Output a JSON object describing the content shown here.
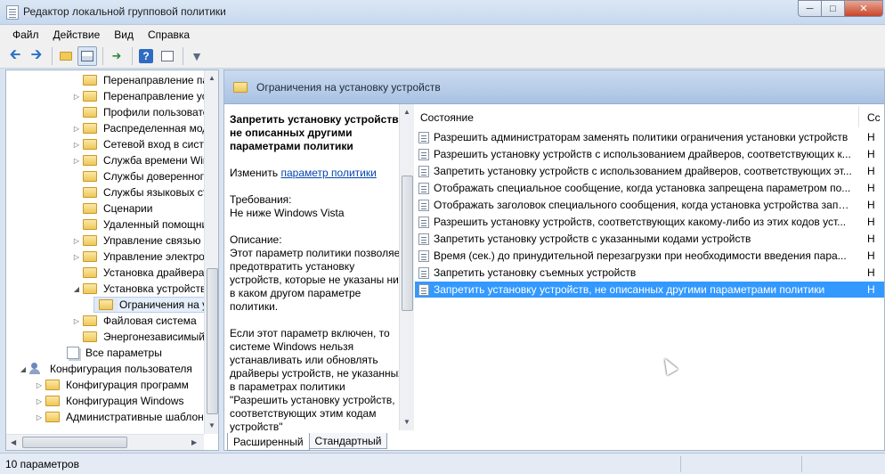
{
  "window": {
    "title": "Редактор локальной групповой политики"
  },
  "menu": [
    "Файл",
    "Действие",
    "Вид",
    "Справка"
  ],
  "tree": {
    "items": [
      {
        "label": "Перенаправление пап",
        "expandable": false
      },
      {
        "label": "Перенаправление устр",
        "expandable": true
      },
      {
        "label": "Профили пользовател",
        "expandable": false
      },
      {
        "label": "Распределенная моде",
        "expandable": true
      },
      {
        "label": "Сетевой вход в систем",
        "expandable": true
      },
      {
        "label": "Служба времени Wind",
        "expandable": true
      },
      {
        "label": "Службы доверенного",
        "expandable": false
      },
      {
        "label": "Службы языковых ста",
        "expandable": false
      },
      {
        "label": "Сценарии",
        "expandable": false
      },
      {
        "label": "Удаленный помощник",
        "expandable": false
      },
      {
        "label": "Управление связью че",
        "expandable": true
      },
      {
        "label": "Управление электропи",
        "expandable": true
      },
      {
        "label": "Установка драйвера",
        "expandable": false
      },
      {
        "label": "Установка устройства",
        "expandable": "open"
      },
      {
        "label": "Ограничения на ус",
        "expandable": false,
        "selected": true
      },
      {
        "label": "Файловая система",
        "expandable": true
      },
      {
        "label": "Энергонезависимый к",
        "expandable": false
      },
      {
        "label": "Все параметры",
        "expandable": false,
        "icon": "pages-icon"
      },
      {
        "label": "Конфигурация пользователя",
        "expandable": "open",
        "icon": "users-icon"
      },
      {
        "label": "Конфигурация программ",
        "expandable": true
      },
      {
        "label": "Конфигурация Windows",
        "expandable": true
      },
      {
        "label": "Административные шаблоны",
        "expandable": true
      }
    ]
  },
  "header": {
    "title": "Ограничения на установку устройств"
  },
  "description": {
    "title": "Запретить установку устройств, не описанных другими параметрами политики",
    "edit_prefix": "Изменить",
    "edit_link": "параметр политики",
    "req_label": "Требования:",
    "req_value": "Не ниже Windows Vista",
    "desc_label": "Описание:",
    "desc_body": "Этот параметр политики позволяет предотвратить установку устройств, которые не указаны ни в каком другом параметре политики.",
    "desc_more": "Если этот параметр включен, то системе Windows нельзя устанавливать или обновлять драйверы устройств, не указанных в параметрах политики \"Разрешить установку устройств, соответствующих этим кодам устройств\""
  },
  "list": {
    "col_state": "Состояние",
    "col_state2": "Сс",
    "rows": [
      {
        "name": "Разрешить администраторам заменять политики ограничения установки устройств",
        "state": "Н"
      },
      {
        "name": "Разрешить установку устройств с использованием драйверов, соответствующих к...",
        "state": "Н"
      },
      {
        "name": "Запретить установку устройств с использованием драйверов, соответствующих эт...",
        "state": "Н"
      },
      {
        "name": "Отображать специальное сообщение, когда установка запрещена параметром по...",
        "state": "Н"
      },
      {
        "name": "Отображать заголовок специального сообщения, когда установка устройства запр...",
        "state": "Н"
      },
      {
        "name": "Разрешить установку устройств, соответствующих какому-либо из этих кодов уст...",
        "state": "Н"
      },
      {
        "name": "Запретить установку устройств с указанными кодами устройств",
        "state": "Н"
      },
      {
        "name": "Время (сек.) до принудительной перезагрузки при необходимости введения пара...",
        "state": "Н"
      },
      {
        "name": "Запретить установку съемных устройств",
        "state": "Н"
      },
      {
        "name": "Запретить установку устройств, не описанных другими параметрами политики",
        "state": "Н",
        "selected": true
      }
    ]
  },
  "tabs": [
    "Расширенный",
    "Стандартный"
  ],
  "status": {
    "text": "10 параметров"
  }
}
